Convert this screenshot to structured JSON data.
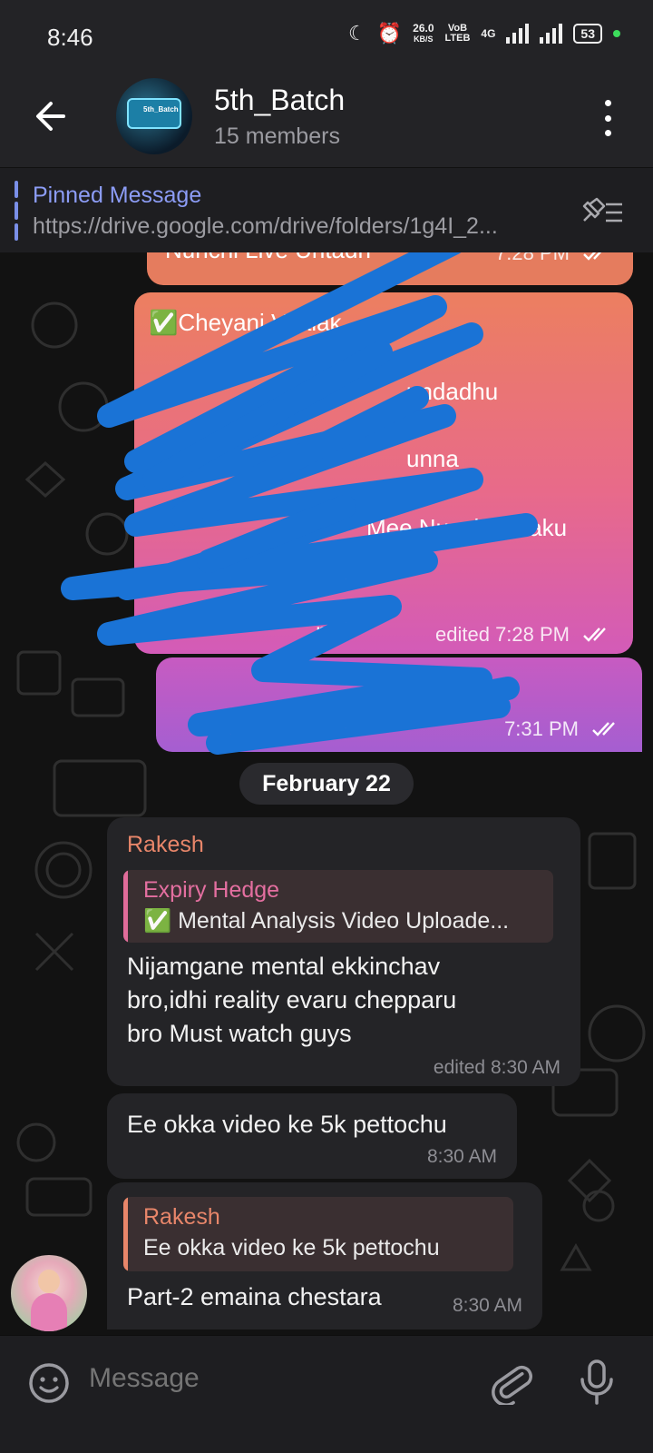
{
  "status_bar": {
    "time": "8:46",
    "net_speed_value": "26.0",
    "net_speed_unit": "KB/S",
    "volte_top": "VoB",
    "volte_bottom": "LTEB",
    "network": "4G",
    "battery": "53"
  },
  "header": {
    "title": "5th_Batch",
    "subtitle": "15 members",
    "avatar_text": "5th_Batch"
  },
  "pinned": {
    "title": "Pinned Message",
    "text": "https://drive.google.com/drive/folders/1g4I_2..."
  },
  "outgoing": [
    {
      "text": "Nunchi Live Untadh",
      "time": "7:28 PM"
    },
    {
      "lines": [
        "✅Cheyani Vaalak",
        "undadhu",
        "unna",
        "Mee Nunchi Naaku",
        "ne"
      ],
      "time": "edited 7:28 PM"
    },
    {
      "text": "",
      "time": "7:31 PM"
    }
  ],
  "date_separator": "February 22",
  "incoming": [
    {
      "sender": "Rakesh",
      "reply": {
        "name": "Expiry Hedge",
        "text": "✅ Mental Analysis Video Uploade..."
      },
      "lines": [
        "Nijamgane mental ekkinchav",
        "bro,idhi reality evaru chepparu",
        "bro Must watch guys"
      ],
      "time": "edited 8:30 AM"
    },
    {
      "text": "Ee okka video ke 5k pettochu",
      "time": "8:30 AM"
    },
    {
      "reply": {
        "name": "Rakesh",
        "text": "Ee okka video ke 5k pettochu"
      },
      "text": "Part-2 emaina chestara",
      "time": "8:30 AM"
    }
  ],
  "input": {
    "placeholder": "Message"
  },
  "colors": {
    "header_bg": "#232326",
    "accent_blue": "#8c9cf5",
    "sender_orange": "#e8866a",
    "reply_pink": "#e06c9a",
    "scribble_blue": "#1a73d6"
  }
}
